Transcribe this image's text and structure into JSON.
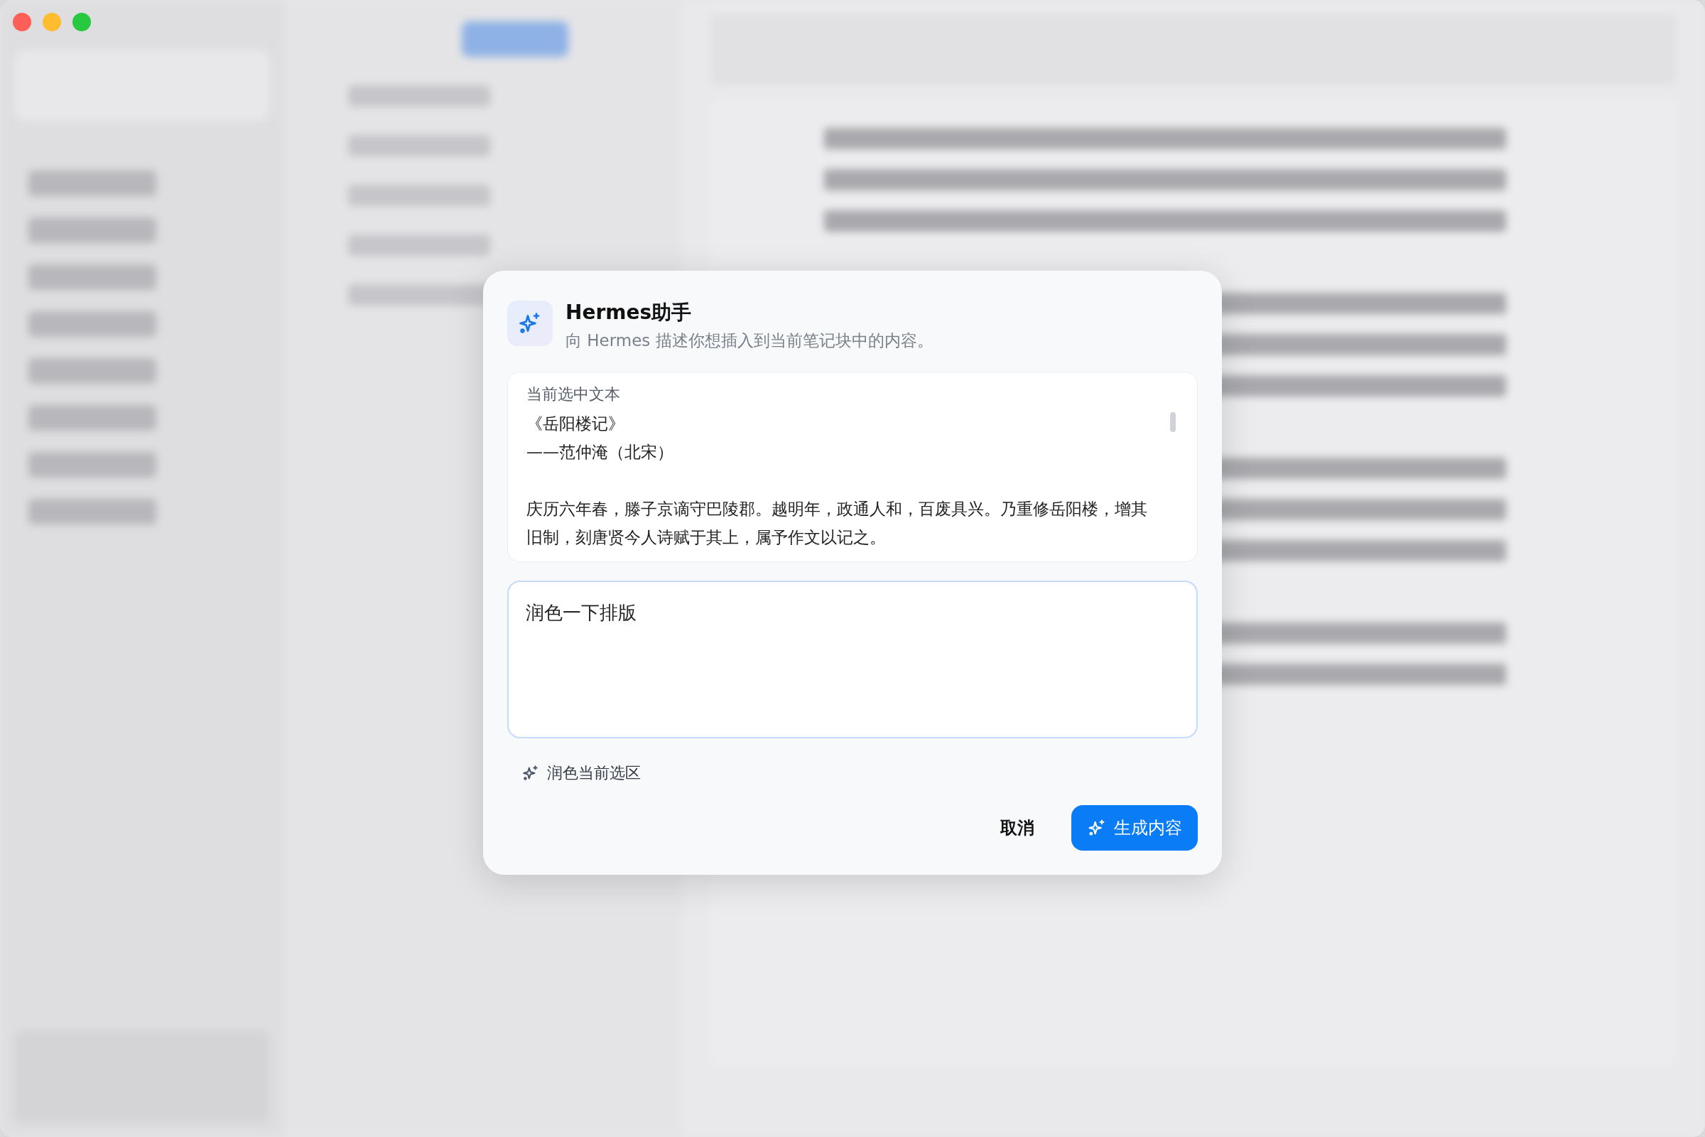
{
  "dialog": {
    "title": "Hermes助手",
    "subtitle": "向 Hermes 描述你想插入到当前笔记块中的内容。",
    "selection": {
      "label": "当前选中文本",
      "paragraphs": [
        [
          "《岳阳楼记》",
          "——范仲淹（北宋）"
        ],
        [
          "庆历六年春，滕子京谪守巴陵郡。越明年，政通人和，百废具兴。乃重修岳阳楼，增其旧制，刻唐贤今人诗赋于其上，属予作文以记之。"
        ]
      ]
    },
    "prompt": {
      "value": "润色一下排版"
    },
    "polish_action": {
      "label": "润色当前选区"
    },
    "buttons": [
      {
        "kind": "text",
        "label": "取消"
      },
      {
        "kind": "primary",
        "label": "生成内容"
      }
    ]
  }
}
